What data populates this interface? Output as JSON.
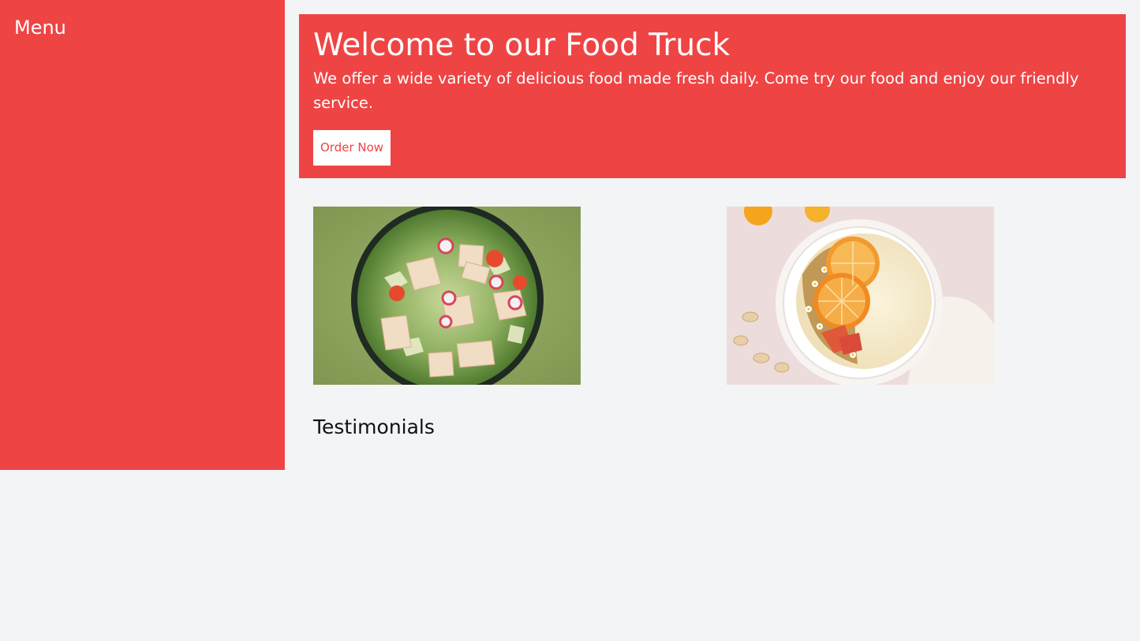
{
  "sidebar": {
    "title": "Menu"
  },
  "hero": {
    "title": "Welcome to our Food Truck",
    "text": "We offer a wide variety of delicious food made fresh daily. Come try our food and enjoy our friendly service.",
    "button_label": "Order Now"
  },
  "gallery": {
    "photos": [
      {
        "subject": "salad bowl"
      },
      {
        "subject": "fruit yogurt bowl"
      }
    ]
  },
  "testimonials": {
    "heading": "Testimonials"
  },
  "colors": {
    "accent": "#ef4444",
    "background": "#f3f4f6",
    "button_bg": "#ffffff",
    "text_on_accent": "#ffffff"
  }
}
